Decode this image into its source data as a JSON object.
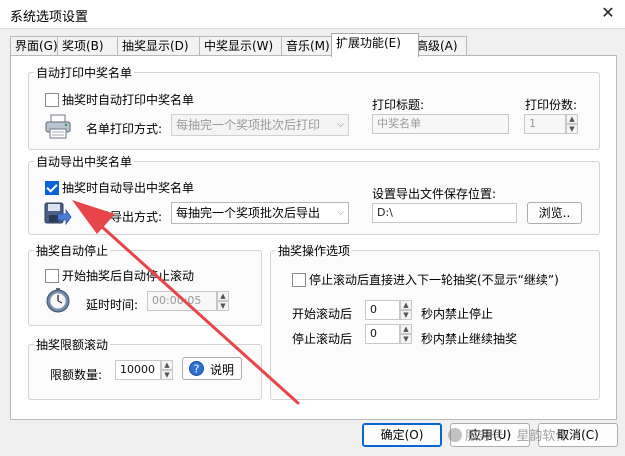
{
  "window": {
    "title": "系统选项设置",
    "close_label": "✕"
  },
  "tabs": [
    {
      "label": "界面(G)"
    },
    {
      "label": "奖项(B)"
    },
    {
      "label": "抽奖显示(D)"
    },
    {
      "label": "中奖显示(W)"
    },
    {
      "label": "音乐(M)"
    },
    {
      "label": "扩展功能(E)",
      "active": true
    },
    {
      "label": "高级(A)"
    }
  ],
  "auto_print": {
    "group_title": "自动打印中奖名单",
    "checkbox_label": "抽奖时自动打印中奖名单",
    "checked": false,
    "mode_label": "名单打印方式:",
    "mode_value": "每抽完一个奖项批次后打印",
    "print_title_label": "打印标题:",
    "print_title_value": "中奖名单",
    "copies_label": "打印份数:",
    "copies_value": "1",
    "icon": "printer-icon"
  },
  "auto_export": {
    "group_title": "自动导出中奖名单",
    "checkbox_label": "抽奖时自动导出中奖名单",
    "checked": true,
    "mode_label": "名单导出方式:",
    "mode_value": "每抽完一个奖项批次后导出",
    "path_label": "设置导出文件保存位置:",
    "path_value": "D:\\",
    "browse_label": "浏览..",
    "icon": "save-export-icon"
  },
  "auto_stop": {
    "group_title": "抽奖自动停止",
    "checkbox_label": "开始抽奖后自动停止滚动",
    "checked": false,
    "delay_label": "延时时间:",
    "delay_value": "00:00:05",
    "icon": "stopwatch-icon"
  },
  "limit_roll": {
    "group_title": "抽奖限额滚动",
    "limit_label": "限额数量:",
    "limit_value": "10000",
    "help_label": "说明",
    "icon": "help-icon"
  },
  "operation": {
    "group_title": "抽奖操作选项",
    "checkbox_label": "停止滚动后直接进入下一轮抽奖(不显示“继续”)",
    "checked": false,
    "start_prefix": "开始滚动后",
    "start_value": "0",
    "start_suffix": "秒内禁止停止",
    "stop_prefix": "停止滚动后",
    "stop_value": "0",
    "stop_suffix": "秒内禁止继续抽奖"
  },
  "footer": {
    "ok_label": "确定(O)",
    "apply_label": "应用(U)",
    "cancel_label": "取消(C)",
    "watermark": "服务号 · 星韵软件"
  },
  "colors": {
    "accent": "#0a64d6",
    "arrow": "#e8454b"
  }
}
